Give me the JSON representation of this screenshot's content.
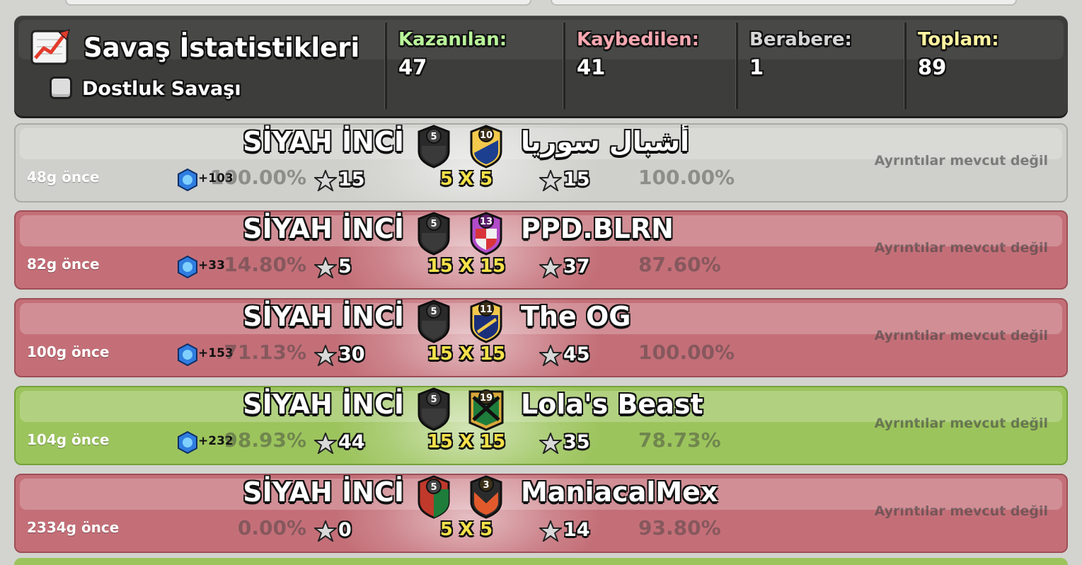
{
  "header": {
    "title": "Savaş İstatistikleri",
    "friendly_label": "Dostluk Savaşı",
    "stats": [
      {
        "label": "Kazanılan:",
        "value": "47",
        "color": "#b9f59a"
      },
      {
        "label": "Kaybedilen:",
        "value": "41",
        "color": "#f7a7b0"
      },
      {
        "label": "Berabere:",
        "value": "1",
        "color": "#d6d6d6"
      },
      {
        "label": "Toplam:",
        "value": "89",
        "color": "#fff3a0"
      }
    ]
  },
  "colors": {
    "draw_row": "#cfcfcb",
    "loss_row": "#c46f78",
    "win_row": "#9cc45d",
    "header_bg": "#3d3d3c",
    "size_text": "#f5e14a"
  },
  "wars": [
    {
      "result": "draw",
      "ago": "48g önce",
      "xp": "+103",
      "my_clan": "SİYAH İNCİ",
      "my_level": "5",
      "my_pct": "100.00%",
      "my_stars": "15",
      "size": "5 X 5",
      "opp_level": "10",
      "opp_clan": "أشبال سوريا",
      "opp_stars": "15",
      "opp_pct": "100.00%",
      "details": "Ayrıntılar mevcut değil"
    },
    {
      "result": "loss",
      "ago": "82g önce",
      "xp": "+33",
      "my_clan": "SİYAH İNCİ",
      "my_level": "5",
      "my_pct": "14.80%",
      "my_stars": "5",
      "size": "15 X 15",
      "opp_level": "13",
      "opp_clan": "PPD.BLRN",
      "opp_stars": "37",
      "opp_pct": "87.60%",
      "details": "Ayrıntılar mevcut değil"
    },
    {
      "result": "loss",
      "ago": "100g önce",
      "xp": "+153",
      "my_clan": "SİYAH İNCİ",
      "my_level": "5",
      "my_pct": "71.13%",
      "my_stars": "30",
      "size": "15 X 15",
      "opp_level": "11",
      "opp_clan": "The OG",
      "opp_stars": "45",
      "opp_pct": "100.00%",
      "details": "Ayrıntılar mevcut değil"
    },
    {
      "result": "win",
      "ago": "104g önce",
      "xp": "+232",
      "my_clan": "SİYAH İNCİ",
      "my_level": "5",
      "my_pct": "98.93%",
      "my_stars": "44",
      "size": "15 X 15",
      "opp_level": "19",
      "opp_clan": "Lola's Beast",
      "opp_stars": "35",
      "opp_pct": "78.73%",
      "details": "Ayrıntılar mevcut değil"
    },
    {
      "result": "loss",
      "ago": "2334g önce",
      "xp": "",
      "my_clan": "SİYAH İNCİ",
      "my_level": "5",
      "my_pct": "0.00%",
      "my_stars": "0",
      "size": "5 X 5",
      "opp_level": "3",
      "opp_clan": "ManiacalMex",
      "opp_stars": "14",
      "opp_pct": "93.80%",
      "details": "Ayrıntılar mevcut değil"
    }
  ]
}
